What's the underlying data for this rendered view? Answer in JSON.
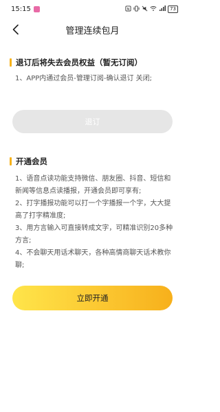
{
  "status_bar": {
    "time": "15:15",
    "icons": [
      "nfc-icon",
      "vibrate-icon",
      "mute-icon",
      "wifi-icon",
      "signal-icon"
    ],
    "battery": "73"
  },
  "header": {
    "title": "管理连续包月",
    "back_icon": "chevron-left-icon"
  },
  "unsubscribe": {
    "title": "退订后将失去会员权益（暂无订阅）",
    "lines": [
      "1、APP内通过会员-管理订阅-确认退订 关闭;"
    ],
    "button_label": "退订"
  },
  "membership": {
    "title": "开通会员",
    "lines": [
      "1、语音点读功能支持微信、朋友圈、抖音、短信和新闻等信息点读播报，开通会员即可享有;",
      "2、打字播报功能可以打一个字播报一个字，大大提高了打字精准度;",
      "3、用方言输入可直接转成文字，可精准识别20多种方言;",
      "4、不会聊天用话术聊天，各种高情商聊天话术教你聊;"
    ],
    "button_label": "立即开通"
  },
  "colors": {
    "accent": "#F7B21A",
    "disabled_button": "#E6E6E6",
    "gradient_start": "#FFE54A",
    "gradient_end": "#F7B01B"
  }
}
